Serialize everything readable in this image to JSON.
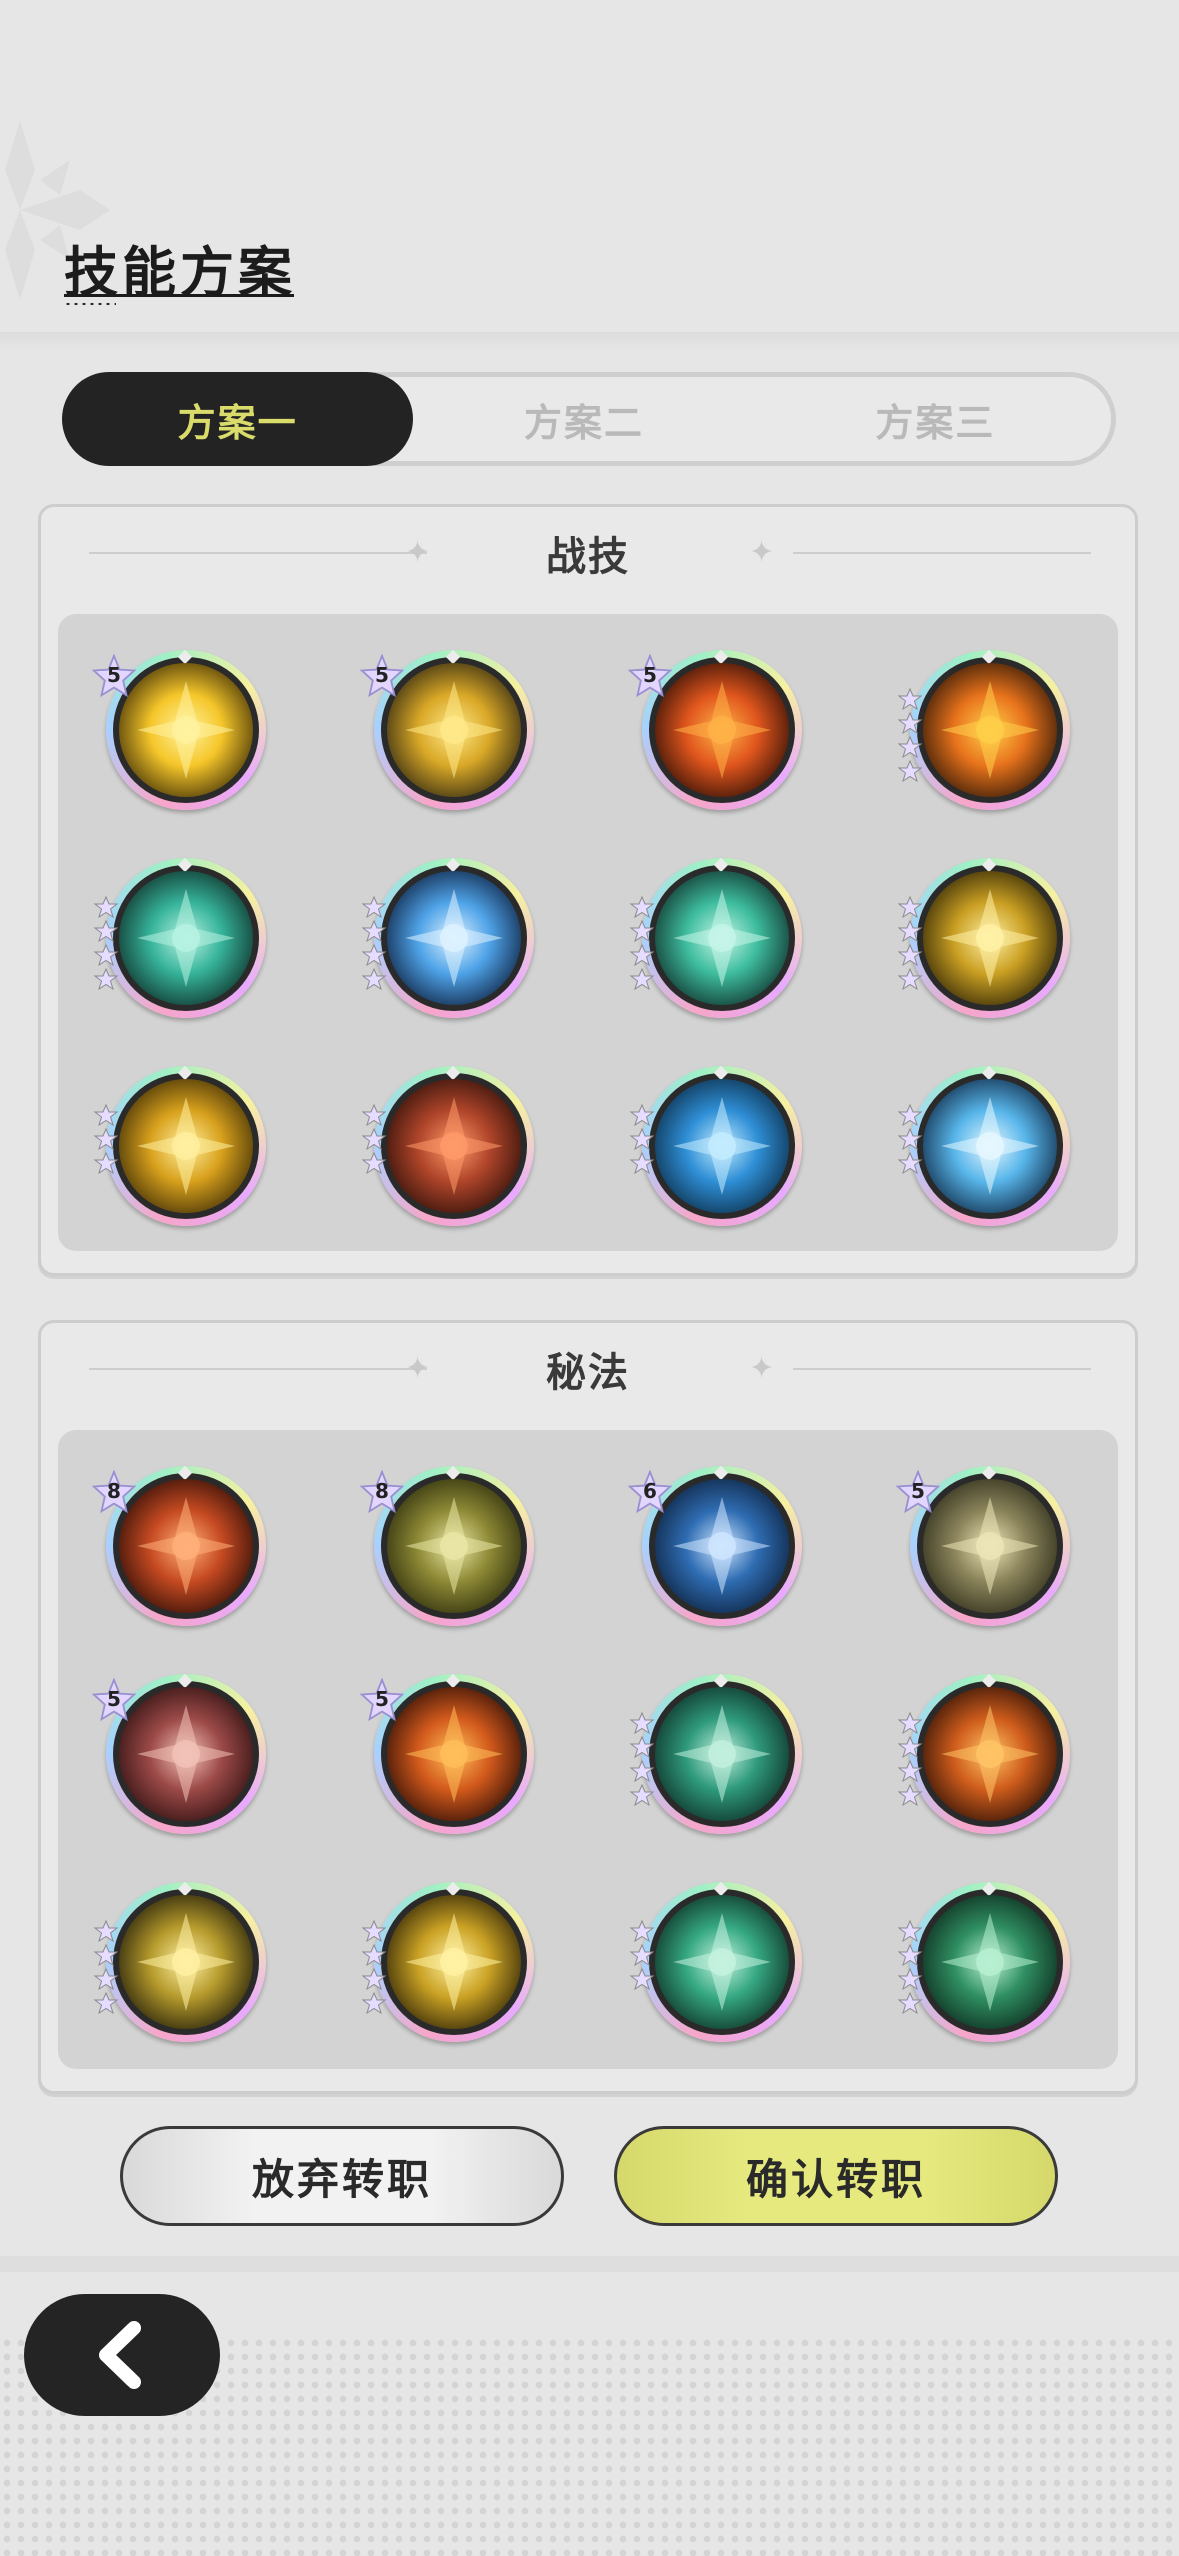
{
  "header": {
    "title": "技能方案"
  },
  "tabs": [
    {
      "label": "方案一",
      "active": true
    },
    {
      "label": "方案二",
      "active": false
    },
    {
      "label": "方案三",
      "active": false
    }
  ],
  "combat": {
    "title": "战技",
    "skills": [
      {
        "icon": "golden-burst-icon",
        "level": "5"
      },
      {
        "icon": "star-sparks-icon",
        "level": "5"
      },
      {
        "icon": "fire-vortex-icon",
        "level": "5"
      },
      {
        "icon": "campfire-icon",
        "stars": 4
      },
      {
        "icon": "wind-swirl-icon",
        "stars": 4
      },
      {
        "icon": "ice-crystal-icon",
        "stars": 4
      },
      {
        "icon": "green-arrow-icon",
        "stars": 4
      },
      {
        "icon": "gold-crystal-icon",
        "stars": 4
      },
      {
        "icon": "lightning-gold-icon",
        "stars": 3
      },
      {
        "icon": "meteor-icon",
        "stars": 3
      },
      {
        "icon": "water-vortex-icon",
        "stars": 3
      },
      {
        "icon": "ice-shards-icon",
        "stars": 3
      }
    ]
  },
  "arcane": {
    "title": "秘法",
    "skills": [
      {
        "icon": "fire-orb-icon",
        "level": "8"
      },
      {
        "icon": "heal-figure-icon",
        "level": "8"
      },
      {
        "icon": "frost-figure-icon",
        "level": "6"
      },
      {
        "icon": "pet-figure-icon",
        "level": "5"
      },
      {
        "icon": "red-heal-figure-icon",
        "level": "5"
      },
      {
        "icon": "fire-sprite-icon",
        "level": "5"
      },
      {
        "icon": "shield-icon",
        "stars": 4
      },
      {
        "icon": "fire-dash-icon",
        "stars": 4
      },
      {
        "icon": "golden-ring-icon",
        "stars": 4
      },
      {
        "icon": "gold-lightning-icon",
        "stars": 4
      },
      {
        "icon": "jade-chain-icon",
        "stars": 3
      },
      {
        "icon": "green-claw-icon",
        "stars": 4
      }
    ]
  },
  "actions": {
    "abandon_label": "放弃转职",
    "confirm_label": "确认转职"
  },
  "colors": {
    "active_tab_text": "#d9dc6b",
    "confirm_button": "#e6e97e"
  }
}
